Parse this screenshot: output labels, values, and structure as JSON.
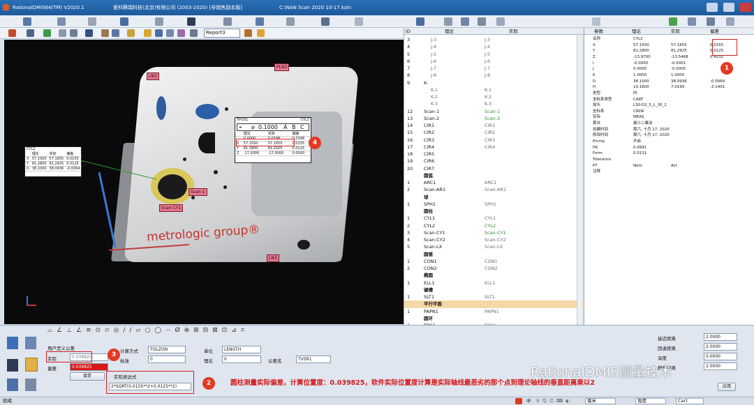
{
  "title": {
    "app": "RationalDMIS64(TM) V2020.1",
    "company": "爱科腾瑞科技(北京)有限公司 (2003-2020) [非销售副本版]",
    "file": "C:\\NAN Scan  2020 10-17.ksln"
  },
  "toolbar": {
    "report_select": "Report3"
  },
  "tags": {
    "ln1": "LN3",
    "ln2": "PLN2",
    "ln3": "LN3",
    "scan1": "Scan-1",
    "scancyl": "Scan-CY1"
  },
  "callout_left": {
    "name": "CYL2",
    "head": [
      "理论",
      "实际",
      "偏差"
    ],
    "rows": [
      [
        "X",
        "57.1500",
        "57.1655",
        "0.0155"
      ],
      [
        "Y",
        "81.2800",
        "81.2925",
        "0.0125"
      ],
      [
        "D",
        "38.1000",
        "38.0936",
        "-0.0064"
      ]
    ]
  },
  "callout_right": {
    "name": "TPOS1",
    "feature": "CYL2",
    "tol": "0.1000",
    "datums": [
      "A",
      "B",
      "C"
    ],
    "head": [
      "理论",
      "实际",
      "偏差"
    ],
    "pos": [
      "0.0000",
      "0.0398",
      "0.0398"
    ],
    "rows": [
      [
        "X",
        "57.1500",
        "57.1655",
        "0.0155"
      ],
      [
        "Y",
        "81.2800",
        "81.2925",
        "0.0125"
      ],
      [
        "Z",
        "-17.0000",
        "-17.0000",
        "0.0000"
      ]
    ]
  },
  "tree": {
    "columns": [
      "ID",
      "理论",
      "实际"
    ],
    "rows": [
      {
        "id": "3",
        "theo": "J-3",
        "act": "J-3",
        "type": "item",
        "sub": true
      },
      {
        "id": "4",
        "theo": "J-4",
        "act": "J-4",
        "type": "item",
        "sub": true
      },
      {
        "id": "5",
        "theo": "J-5",
        "act": "J-5",
        "type": "item",
        "sub": true
      },
      {
        "id": "6",
        "theo": "J-6",
        "act": "J-6",
        "type": "item",
        "sub": true
      },
      {
        "id": "7",
        "theo": "J-7",
        "act": "J-7",
        "type": "item",
        "sub": true
      },
      {
        "id": "8",
        "theo": "J-8",
        "act": "J-8",
        "type": "item",
        "sub": true
      },
      {
        "id": "9",
        "theo": "K-",
        "act": "",
        "type": "item",
        "sub": false
      },
      {
        "id": "",
        "theo": "K-1",
        "act": "K-1",
        "type": "item",
        "sub": true
      },
      {
        "id": "",
        "theo": "K-2",
        "act": "K-2",
        "type": "item",
        "sub": true
      },
      {
        "id": "",
        "theo": "K-3",
        "act": "K-3",
        "type": "item",
        "sub": true
      },
      {
        "id": "12",
        "theo": "Scan-1",
        "act": "Scan-1",
        "type": "green",
        "sub": false
      },
      {
        "id": "13",
        "theo": "Scan-2",
        "act": "Scan-2",
        "type": "green",
        "sub": false
      },
      {
        "id": "14",
        "theo": "CIR1",
        "act": "CIR1",
        "type": "item",
        "sub": false
      },
      {
        "id": "15",
        "theo": "CIR2",
        "act": "CIR2",
        "type": "item",
        "sub": false
      },
      {
        "id": "16",
        "theo": "CIR3",
        "act": "CIR3",
        "type": "item",
        "sub": false
      },
      {
        "id": "17",
        "theo": "CIR4",
        "act": "CIR4",
        "type": "item",
        "sub": false
      },
      {
        "id": "18",
        "theo": "CIR5",
        "act": "",
        "type": "item",
        "sub": false
      },
      {
        "id": "19",
        "theo": "CIR6",
        "act": "",
        "type": "item",
        "sub": false
      },
      {
        "id": "20",
        "theo": "CIR7",
        "act": "",
        "type": "item",
        "sub": false
      },
      {
        "id": "",
        "theo": "圆弧",
        "act": "",
        "type": "group",
        "sub": false
      },
      {
        "id": "1",
        "theo": "ARC1",
        "act": "ARC1",
        "type": "item",
        "sub": false
      },
      {
        "id": "2",
        "theo": "Scan-AR1",
        "act": "Scan-AR1",
        "type": "item",
        "sub": false
      },
      {
        "id": "",
        "theo": "球",
        "act": "",
        "type": "group",
        "sub": false
      },
      {
        "id": "1",
        "theo": "SPH1",
        "act": "SPH1",
        "type": "item",
        "sub": false
      },
      {
        "id": "",
        "theo": "圆柱",
        "act": "",
        "type": "group",
        "sub": false
      },
      {
        "id": "1",
        "theo": "CYL1",
        "act": "CYL1",
        "type": "item",
        "sub": false
      },
      {
        "id": "2",
        "theo": "CYL2",
        "act": "CYL2",
        "type": "green",
        "sub": false
      },
      {
        "id": "3",
        "theo": "Scan-CY1",
        "act": "Scan-CY1",
        "type": "green",
        "sub": false
      },
      {
        "id": "4",
        "theo": "Scan-CY2",
        "act": "Scan-CY2",
        "type": "item",
        "sub": false
      },
      {
        "id": "5",
        "theo": "Scan-LX",
        "act": "Scan-LX",
        "type": "item",
        "sub": false
      },
      {
        "id": "",
        "theo": "圆锥",
        "act": "",
        "type": "group",
        "sub": false
      },
      {
        "id": "1",
        "theo": "CON1",
        "act": "CON1",
        "type": "item",
        "sub": false
      },
      {
        "id": "2",
        "theo": "CON2",
        "act": "CON2",
        "type": "item",
        "sub": false
      },
      {
        "id": "",
        "theo": "椭圆",
        "act": "",
        "type": "group",
        "sub": false
      },
      {
        "id": "1",
        "theo": "ELL1",
        "act": "ELL1",
        "type": "item",
        "sub": false
      },
      {
        "id": "",
        "theo": "键槽",
        "act": "",
        "type": "group",
        "sub": false
      },
      {
        "id": "1",
        "theo": "SLT1",
        "act": "SLT1",
        "type": "item",
        "sub": false
      },
      {
        "id": "",
        "theo": "平行平面",
        "act": "",
        "type": "highlight",
        "sub": false
      },
      {
        "id": "1",
        "theo": "PAPN1",
        "act": "PAPN1",
        "type": "item",
        "sub": false
      },
      {
        "id": "",
        "theo": "圆环",
        "act": "",
        "type": "group",
        "sub": false
      },
      {
        "id": "1",
        "theo": "TRS1",
        "act": "TRS1",
        "type": "item",
        "sub": false
      }
    ]
  },
  "props": {
    "columns": [
      "参数",
      "理论",
      "实际",
      "偏差"
    ],
    "rows": [
      [
        "名称",
        "CYL2",
        "",
        ""
      ],
      [
        "X",
        "57.1500",
        "57.1655",
        "0.0155"
      ],
      [
        "Y",
        "81.2800",
        "81.2925",
        "0.0125"
      ],
      [
        "Z",
        "-13.9700",
        "-13.5468",
        "0.4232"
      ],
      [
        "I",
        "-0.0000",
        "-0.0001",
        ""
      ],
      [
        "J",
        "0.0000",
        "-0.0005",
        ""
      ],
      [
        "K",
        "1.0000",
        "1.0000",
        ""
      ],
      [
        "D",
        "38.1000",
        "38.0936",
        "-0.0064"
      ],
      [
        "H",
        "10.1600",
        "7.0199",
        "-3.1401"
      ],
      [
        "类型",
        "内",
        "",
        ""
      ],
      [
        "坐标系类型",
        "CART",
        "",
        ""
      ],
      [
        "探头",
        "L30-D2_5_L_30_2",
        "",
        ""
      ],
      [
        "坐标系",
        "CRD6",
        "",
        ""
      ],
      [
        "实际",
        "MEAS",
        "",
        ""
      ],
      [
        "算法",
        "最小二乘法",
        "",
        ""
      ],
      [
        "创建时间",
        "周六, 十月 17, 2020",
        "",
        ""
      ],
      [
        "修改时间",
        "周六, 十月 17, 2020",
        "",
        ""
      ],
      [
        "Prcmp",
        "开启",
        "",
        ""
      ],
      [
        "PR",
        "0.9991",
        "",
        ""
      ],
      [
        "Form",
        "0.0131",
        "",
        ""
      ],
      [
        "Tolerance",
        "",
        "",
        ""
      ],
      [
        "PT",
        "Nom",
        "Act",
        ""
      ],
      [
        "注释",
        "",
        "",
        ""
      ]
    ]
  },
  "bottom": {
    "user_tol_label": "用户定义公差",
    "actual_label": "实际",
    "actual_value": "0.039825",
    "dev_label": "偏差",
    "dev_value": "0.039825",
    "apply_btn": "接受",
    "calc_label": "计算方式",
    "calc_value": "TOLZON",
    "nominal_label": "标准",
    "nominal_value": "0",
    "unit_label": "单位",
    "unit_value": "LENGTH",
    "theo_label": "理论",
    "theo_value": "0",
    "tolname_label": "公差名",
    "tolname_value": "TVSR1",
    "expr_label": "实际表达式",
    "expr_value": "2*SQRT(0.0155**2+0.0125**2)",
    "right_labels": [
      "接近距离",
      "回退距离",
      "深度",
      "搜索距离"
    ],
    "right_values": [
      "2.0000",
      "2.0000",
      "0.0000",
      "2.0000"
    ],
    "apply2": "应用",
    "note": "圆柱测量实际偏差，计算位置度：0.039825，软件实际位置度计算是实际轴线最恶劣的那个点到理论轴线的垂直距离乘以2"
  },
  "badges": [
    "1",
    "2",
    "3",
    "4"
  ],
  "status": {
    "left": "就绪",
    "unit1": "毫米",
    "unit2": "角度",
    "cs": "Cart",
    "ime": "中"
  },
  "watermark": "RationalDMIS测量技术"
}
